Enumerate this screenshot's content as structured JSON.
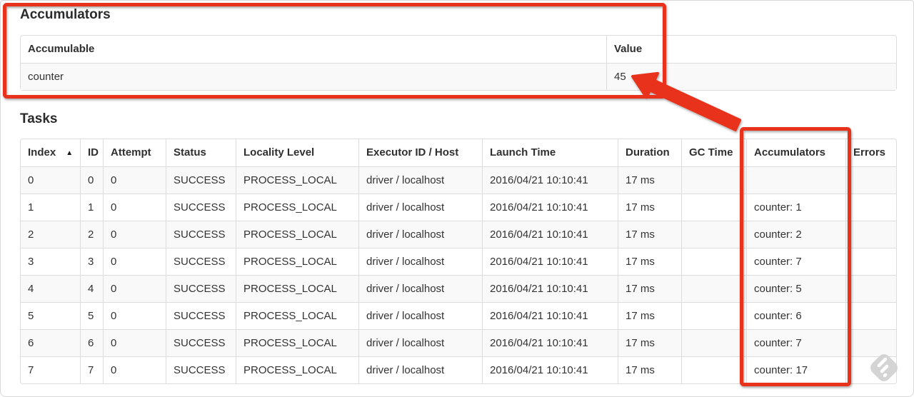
{
  "accumulators_section": {
    "title": "Accumulators",
    "table": {
      "headers": {
        "accumulable": "Accumulable",
        "value": "Value"
      },
      "row": {
        "accumulable": "counter",
        "value": "45"
      }
    }
  },
  "tasks_section": {
    "title": "Tasks",
    "table": {
      "headers": {
        "index": "Index",
        "id": "ID",
        "attempt": "Attempt",
        "status": "Status",
        "locality": "Locality Level",
        "executor": "Executor ID / Host",
        "launch": "Launch Time",
        "duration": "Duration",
        "gc": "GC Time",
        "accumulators": "Accumulators",
        "errors": "Errors"
      },
      "sort_indicator": "▲",
      "rows": [
        {
          "index": "0",
          "id": "0",
          "attempt": "0",
          "status": "SUCCESS",
          "locality": "PROCESS_LOCAL",
          "executor": "driver / localhost",
          "launch": "2016/04/21 10:10:41",
          "duration": "17 ms",
          "gc": "",
          "accumulators": "",
          "errors": ""
        },
        {
          "index": "1",
          "id": "1",
          "attempt": "0",
          "status": "SUCCESS",
          "locality": "PROCESS_LOCAL",
          "executor": "driver / localhost",
          "launch": "2016/04/21 10:10:41",
          "duration": "17 ms",
          "gc": "",
          "accumulators": "counter: 1",
          "errors": ""
        },
        {
          "index": "2",
          "id": "2",
          "attempt": "0",
          "status": "SUCCESS",
          "locality": "PROCESS_LOCAL",
          "executor": "driver / localhost",
          "launch": "2016/04/21 10:10:41",
          "duration": "17 ms",
          "gc": "",
          "accumulators": "counter: 2",
          "errors": ""
        },
        {
          "index": "3",
          "id": "3",
          "attempt": "0",
          "status": "SUCCESS",
          "locality": "PROCESS_LOCAL",
          "executor": "driver / localhost",
          "launch": "2016/04/21 10:10:41",
          "duration": "17 ms",
          "gc": "",
          "accumulators": "counter: 7",
          "errors": ""
        },
        {
          "index": "4",
          "id": "4",
          "attempt": "0",
          "status": "SUCCESS",
          "locality": "PROCESS_LOCAL",
          "executor": "driver / localhost",
          "launch": "2016/04/21 10:10:41",
          "duration": "17 ms",
          "gc": "",
          "accumulators": "counter: 5",
          "errors": ""
        },
        {
          "index": "5",
          "id": "5",
          "attempt": "0",
          "status": "SUCCESS",
          "locality": "PROCESS_LOCAL",
          "executor": "driver / localhost",
          "launch": "2016/04/21 10:10:41",
          "duration": "17 ms",
          "gc": "",
          "accumulators": "counter: 6",
          "errors": ""
        },
        {
          "index": "6",
          "id": "6",
          "attempt": "0",
          "status": "SUCCESS",
          "locality": "PROCESS_LOCAL",
          "executor": "driver / localhost",
          "launch": "2016/04/21 10:10:41",
          "duration": "17 ms",
          "gc": "",
          "accumulators": "counter: 7",
          "errors": ""
        },
        {
          "index": "7",
          "id": "7",
          "attempt": "0",
          "status": "SUCCESS",
          "locality": "PROCESS_LOCAL",
          "executor": "driver / localhost",
          "launch": "2016/04/21 10:10:41",
          "duration": "17 ms",
          "gc": "",
          "accumulators": "counter: 17",
          "errors": ""
        }
      ]
    }
  },
  "annotations": {
    "color": "#e8311f",
    "highlighted_value": "45",
    "highlighted_column": "Accumulators"
  }
}
